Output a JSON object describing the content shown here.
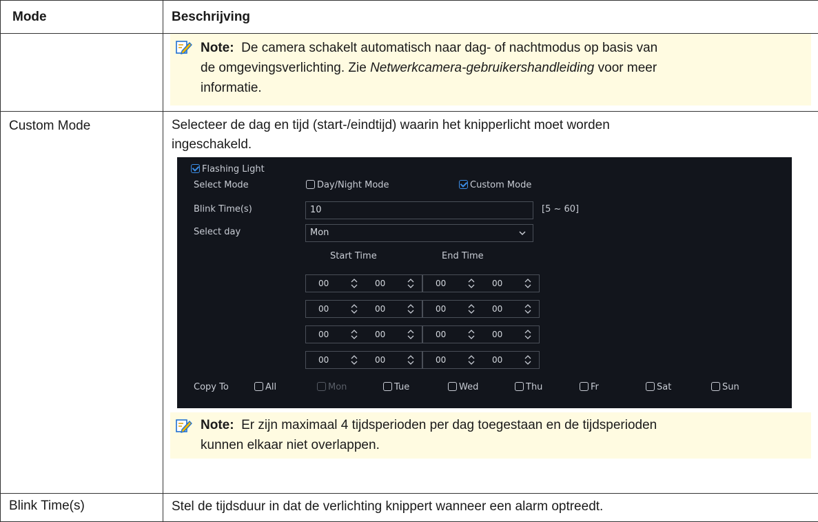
{
  "table": {
    "header": {
      "col1": "Mode",
      "col2": "Beschrijving"
    },
    "row1": {
      "note_label": "Note:",
      "note_text_1": "De camera schakelt automatisch naar dag- of nachtmodus op basis van",
      "note_text_2a": "de omgevingsverlichting. Zie ",
      "note_text_2_italic": "Netwerkcamera-gebruikershandleiding",
      "note_text_2b": " voor meer",
      "note_text_3": "informatie."
    },
    "row2": {
      "mode": "Custom Mode",
      "description_1": "Selecteer de dag en tijd (start-/eindtijd) waarin het knipperlicht moet worden",
      "description_2": "ingeschakeld.",
      "note_label": "Note:",
      "note_text_1": "Er zijn maximaal 4 tijdsperioden per dag toegestaan en de tijdsperioden",
      "note_text_2": "kunnen elkaar niet overlappen."
    },
    "row3": {
      "mode": "Blink Time(s)",
      "description": "Stel de tijdsduur in dat de verlichting knippert wanneer een alarm optreedt."
    }
  },
  "screenshot": {
    "flashing_light_label": "Flashing Light",
    "flashing_light_checked": true,
    "select_mode_label": "Select Mode",
    "mode_options": [
      {
        "label": "Day/Night Mode",
        "checked": false
      },
      {
        "label": "Custom Mode",
        "checked": true
      }
    ],
    "blink_time_label": "Blink Time(s)",
    "blink_time_value": "10",
    "blink_time_range": "[5 ~ 60]",
    "select_day_label": "Select day",
    "select_day_value": "Mon",
    "start_time_label": "Start Time",
    "end_time_label": "End Time",
    "periods": [
      {
        "start_h": "00",
        "start_m": "00",
        "end_h": "00",
        "end_m": "00"
      },
      {
        "start_h": "00",
        "start_m": "00",
        "end_h": "00",
        "end_m": "00"
      },
      {
        "start_h": "00",
        "start_m": "00",
        "end_h": "00",
        "end_m": "00"
      },
      {
        "start_h": "00",
        "start_m": "00",
        "end_h": "00",
        "end_m": "00"
      }
    ],
    "copy_to_label": "Copy To",
    "copy_days": [
      {
        "label": "All",
        "disabled": false
      },
      {
        "label": "Mon",
        "disabled": true
      },
      {
        "label": "Tue",
        "disabled": false
      },
      {
        "label": "Wed",
        "disabled": false
      },
      {
        "label": "Thu",
        "disabled": false
      },
      {
        "label": "Fr",
        "disabled": false
      },
      {
        "label": "Sat",
        "disabled": false
      },
      {
        "label": "Sun",
        "disabled": false
      }
    ],
    "colors": {
      "background": "#12151c",
      "accent": "#3b8ee8",
      "text": "#c8ccd4"
    }
  },
  "icons": {
    "note": "note-pencil-icon",
    "checkbox": "checkbox-icon",
    "spinner": "spinner-icon",
    "chevron": "chevron-down-icon"
  }
}
